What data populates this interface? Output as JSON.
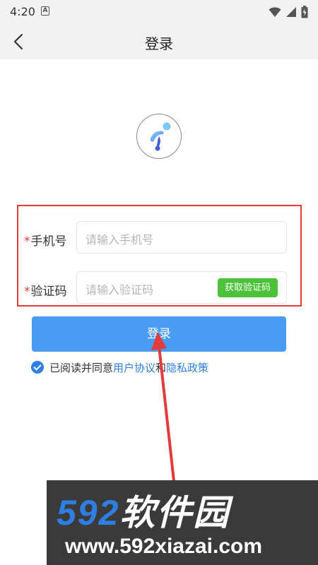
{
  "status_bar": {
    "time": "4:20",
    "notification_letter": "A"
  },
  "nav": {
    "title": "登录"
  },
  "form": {
    "phone": {
      "required_mark": "*",
      "label": "手机号",
      "placeholder": "请输入手机号"
    },
    "code": {
      "required_mark": "*",
      "label": "验证码",
      "placeholder": "请输入验证码",
      "button_label": "获取验证码"
    }
  },
  "login_button": {
    "label": "登录"
  },
  "agreement": {
    "checked": true,
    "prefix": "已阅读并同意",
    "user_agreement": "用户协议",
    "conjunction": "和",
    "privacy_policy": "隐私政策"
  },
  "watermark": {
    "number": "592",
    "name": "软件园",
    "url": "www.592xiazai.com"
  },
  "colors": {
    "accent_blue": "#4a9cf3",
    "link_blue": "#2f7fe3",
    "code_button_green": "#4cc13a",
    "highlight_red": "#e23b3b"
  }
}
